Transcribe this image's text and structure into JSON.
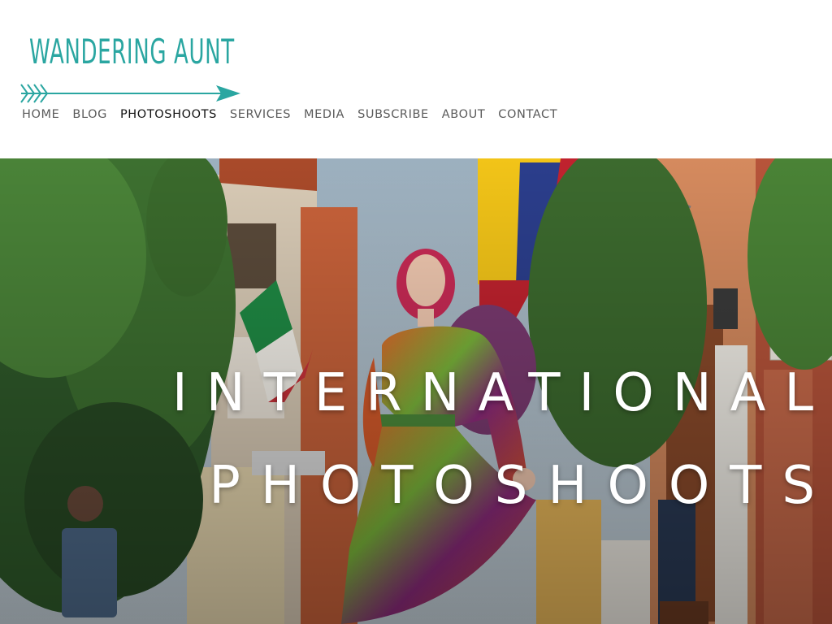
{
  "site": {
    "logo_text": "WANDERING AUNT",
    "accent_color": "#2aa6a1"
  },
  "nav": {
    "items": [
      {
        "label": "HOME"
      },
      {
        "label": "BLOG"
      },
      {
        "label": "PHOTOSHOOTS",
        "active": true
      },
      {
        "label": "SERVICES"
      },
      {
        "label": "MEDIA"
      },
      {
        "label": "SUBSCRIBE"
      },
      {
        "label": "ABOUT"
      },
      {
        "label": "CONTACT"
      }
    ]
  },
  "hero": {
    "title_line1": "INTERNATIONAL",
    "title_line2": "PHOTOSHOOTS"
  }
}
